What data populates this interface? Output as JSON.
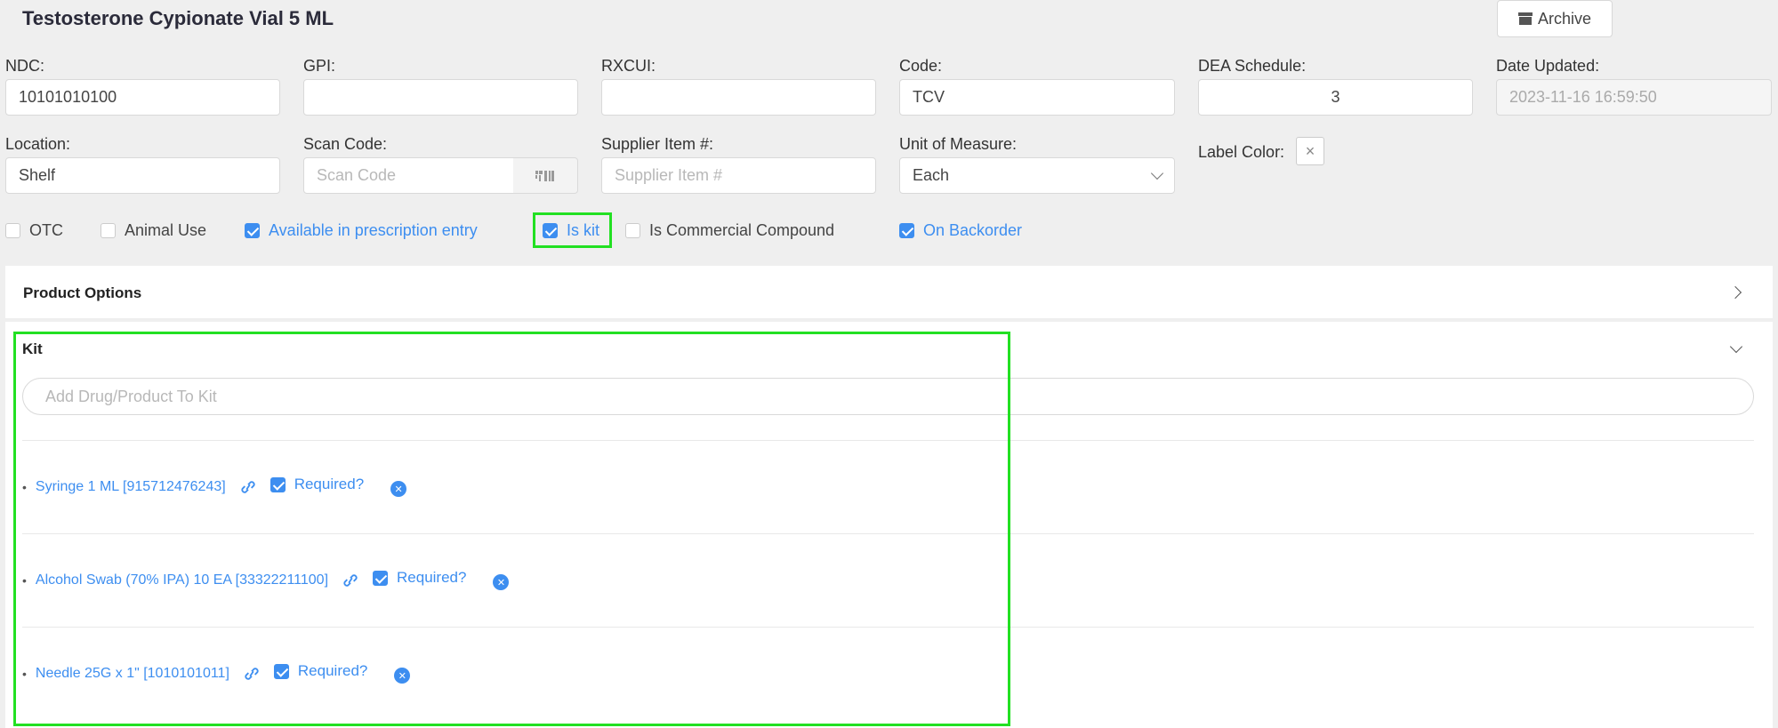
{
  "product": {
    "title": "Testosterone Cypionate Vial 5 ML",
    "archive_label": "Archive"
  },
  "fields": {
    "ndc": {
      "label": "NDC:",
      "value": "10101010100"
    },
    "gpi": {
      "label": "GPI:",
      "value": ""
    },
    "rxcui": {
      "label": "RXCUI:",
      "value": ""
    },
    "code": {
      "label": "Code:",
      "value": "TCV"
    },
    "dea": {
      "label": "DEA Schedule:",
      "value": "3"
    },
    "date_updated": {
      "label": "Date Updated:",
      "value": "2023-11-16 16:59:50"
    },
    "location": {
      "label": "Location:",
      "value": "Shelf"
    },
    "scan_code": {
      "label": "Scan Code:",
      "placeholder": "Scan Code"
    },
    "supplier_item": {
      "label": "Supplier Item #:",
      "placeholder": "Supplier Item #"
    },
    "unit_of_measure": {
      "label": "Unit of Measure:",
      "value": "Each"
    },
    "label_color": {
      "label": "Label Color:"
    }
  },
  "checkboxes": [
    {
      "label": "OTC",
      "checked": false
    },
    {
      "label": "Animal Use",
      "checked": false
    },
    {
      "label": "Available in prescription entry",
      "checked": true
    },
    {
      "label": "Is kit",
      "checked": true
    },
    {
      "label": "Is Commercial Compound",
      "checked": false
    },
    {
      "label": "On Backorder",
      "checked": true
    }
  ],
  "panels": {
    "product_options": {
      "title": "Product Options"
    },
    "kit": {
      "title": "Kit",
      "search_placeholder": "Add Drug/Product To Kit",
      "required_label": "Required?",
      "items": [
        {
          "name": "Syringe 1 ML [915712476243]",
          "required": true
        },
        {
          "name": "Alcohol Swab (70% IPA) 10 EA [33322211100]",
          "required": true
        },
        {
          "name": "Needle 25G x 1\" [1010101011]",
          "required": true
        }
      ]
    }
  },
  "colors": {
    "accent": "#3d8ef0",
    "highlight": "#22e022",
    "background": "#efefef"
  }
}
